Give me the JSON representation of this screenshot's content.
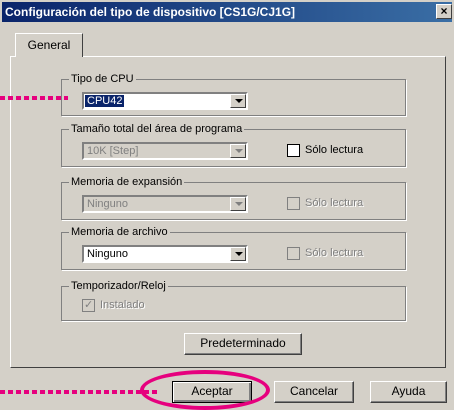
{
  "window": {
    "title": "Configuración del tipo de dispositivo [CS1G/CJ1G]",
    "close_glyph": "×"
  },
  "tabs": [
    {
      "label": "General"
    }
  ],
  "groups": {
    "cpu": {
      "label": "Tipo de CPU",
      "value": "CPU42"
    },
    "program": {
      "label": "Tamaño total del área de programa",
      "value": "10K [Step]",
      "checkbox_label": "Sólo lectura",
      "checked": false
    },
    "expansion": {
      "label": "Memoria de expansión",
      "value": "Ninguno",
      "checkbox_label": "Sólo lectura",
      "checked": false
    },
    "file": {
      "label": "Memoria de archivo",
      "value": "Ninguno",
      "checkbox_label": "Sólo lectura",
      "checked": false
    },
    "timer": {
      "label": "Temporizador/Reloj",
      "checkbox_label": "Instalado",
      "checked": true
    }
  },
  "buttons": {
    "defaults": "Predeterminado",
    "ok": "Aceptar",
    "cancel": "Cancelar",
    "help": "Ayuda"
  },
  "colors": {
    "accent_annotation": "#e6007e",
    "titlebar": "#0a246a"
  }
}
